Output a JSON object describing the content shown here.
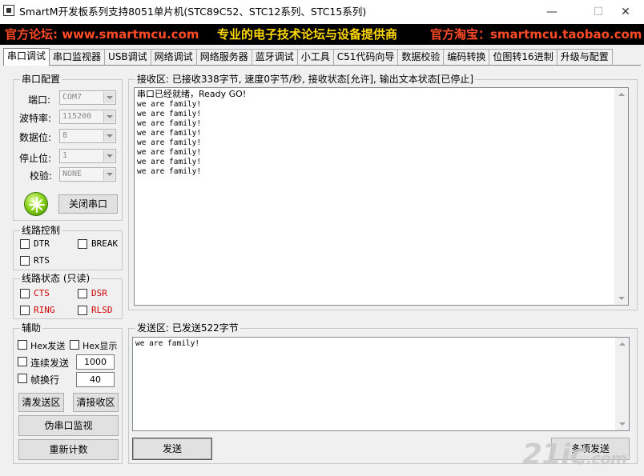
{
  "window": {
    "title": "SmartM开发板系列支持8051单片机(STC89C52、STC12系列、STC15系列)",
    "minimize": "—",
    "maximize": "☐",
    "close": "✕"
  },
  "banner": {
    "left": "官方论坛: www.smartmcu.com",
    "center": "专业的电子技术论坛与设备提供商",
    "right": "官方淘宝：smartmcu.taobao.com"
  },
  "tabs": [
    "串口调试",
    "串口监视器",
    "USB调试",
    "网络调试",
    "网络服务器",
    "蓝牙调试",
    "小工具",
    "C51代码向导",
    "数据校验",
    "编码转换",
    "位图转16进制",
    "升级与配置"
  ],
  "serial_config": {
    "title": "串口配置",
    "port_label": "端口:",
    "port_value": "COM7",
    "baud_label": "波特率:",
    "baud_value": "115200",
    "databits_label": "数据位:",
    "databits_value": "8",
    "stopbits_label": "停止位:",
    "stopbits_value": "1",
    "parity_label": "校验:",
    "parity_value": "NONE",
    "close_button": "关闭串口"
  },
  "line_control": {
    "title": "线路控制",
    "dtr": "DTR",
    "brk": "BREAK",
    "rts": "RTS"
  },
  "line_status": {
    "title": "线路状态 (只读)",
    "cts": "CTS",
    "dsr": "DSR",
    "ring": "RING",
    "rlsd": "RLSD"
  },
  "aux": {
    "title": "辅助",
    "hex_send": "Hex发送",
    "hex_show": "Hex显示",
    "continuous": "连续发送",
    "continuous_value": "1000",
    "frame": "帧换行",
    "frame_value": "40",
    "clear_send": "清发送区",
    "clear_recv": "清接收区",
    "pseudo_monitor": "伪串口监视",
    "reset_count": "重新计数"
  },
  "receive": {
    "title": "接收区: 已接收338字节, 速度0字节/秒, 接收状态[允许], 输出文本状态[已停止]",
    "lines": [
      "串口已经就绪，Ready GO!",
      "we are family!",
      "we are family!",
      "we are family!",
      "we are family!",
      "we are family!",
      "we are family!",
      "we are family!",
      "we are family!"
    ]
  },
  "send": {
    "title": "发送区: 已发送522字节",
    "text": "we are family!",
    "send_button": "发送",
    "multi_button": "多项发送"
  },
  "watermark": {
    "main": "21ic",
    "suffix": ".com"
  }
}
